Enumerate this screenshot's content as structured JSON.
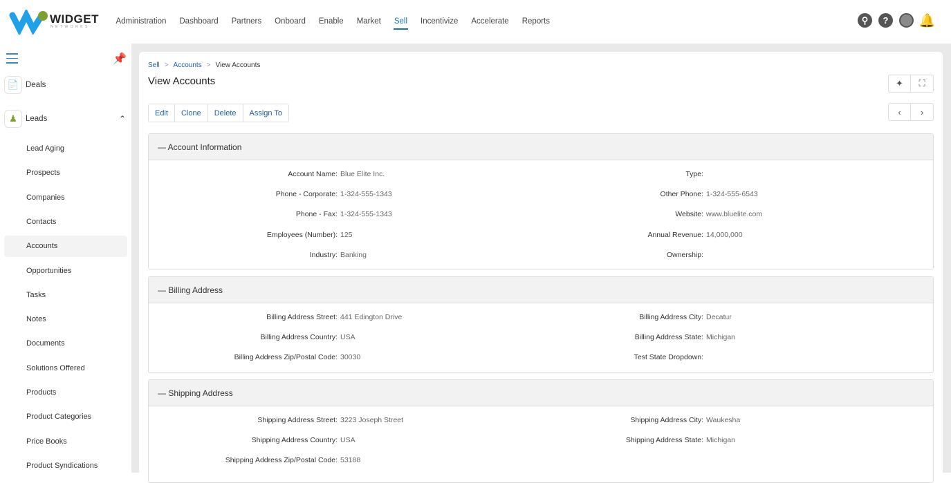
{
  "brand": {
    "name": "WIDGET",
    "sub": "NETWORKS"
  },
  "nav": [
    "Administration",
    "Dashboard",
    "Partners",
    "Onboard",
    "Enable",
    "Market",
    "Sell",
    "Incentivize",
    "Accelerate",
    "Reports"
  ],
  "nav_active": "Sell",
  "sidebar": {
    "groups": [
      {
        "label": "Deals"
      },
      {
        "label": "Leads"
      }
    ],
    "items": [
      "Lead Aging",
      "Prospects",
      "Companies",
      "Contacts",
      "Accounts",
      "Opportunities",
      "Tasks",
      "Notes",
      "Documents",
      "Solutions Offered",
      "Products",
      "Product Categories",
      "Price Books",
      "Product Syndications"
    ],
    "active": "Accounts"
  },
  "breadcrumb": [
    "Sell",
    "Accounts",
    "View Accounts"
  ],
  "title": "View Accounts",
  "actions": [
    "Edit",
    "Clone",
    "Delete",
    "Assign To"
  ],
  "sections": [
    {
      "title": "Account Information",
      "left": [
        [
          "Account Name:",
          "Blue Elite Inc."
        ],
        [
          "Phone - Corporate:",
          "1-324-555-1343"
        ],
        [
          "Phone - Fax:",
          "1-324-555-1343"
        ],
        [
          "Employees (Number):",
          "125"
        ],
        [
          "Industry:",
          "Banking"
        ]
      ],
      "right": [
        [
          "Type:",
          ""
        ],
        [
          "Other Phone:",
          "1-324-555-6543"
        ],
        [
          "Website:",
          "www.bluelite.com"
        ],
        [
          "Annual Revenue:",
          "14,000,000"
        ],
        [
          "Ownership:",
          ""
        ]
      ]
    },
    {
      "title": "Billing Address",
      "left": [
        [
          "Billing Address Street:",
          "441 Edington Drive"
        ],
        [
          "Billing Address Country:",
          "USA"
        ],
        [
          "Billing Address Zip/Postal Code:",
          "30030"
        ]
      ],
      "right": [
        [
          "Billing Address City:",
          "Decatur"
        ],
        [
          "Billing Address State:",
          "Michigan"
        ],
        [
          "Test State Dropdown:",
          ""
        ]
      ]
    },
    {
      "title": "Shipping Address",
      "left": [
        [
          "Shipping Address Street:",
          "3223 Joseph Street"
        ],
        [
          "Shipping Address Country:",
          "USA"
        ],
        [
          "Shipping Address Zip/Postal Code:",
          "53188"
        ]
      ],
      "right": [
        [
          "Shipping Address City:",
          "Waukesha"
        ],
        [
          "Shipping Address State:",
          "Michigan"
        ]
      ]
    }
  ]
}
